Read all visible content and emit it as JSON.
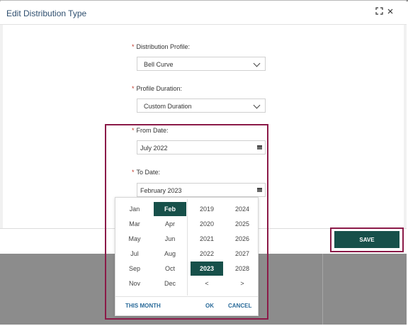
{
  "dialog": {
    "title": "Edit Distribution Type"
  },
  "form": {
    "distribution_profile": {
      "label": "Distribution Profile:",
      "required_mark": "*",
      "value": "Bell Curve"
    },
    "profile_duration": {
      "label": "Profile Duration:",
      "required_mark": "*",
      "value": "Custom Duration"
    },
    "from_date": {
      "label": "From Date:",
      "required_mark": "*",
      "value": "July 2022"
    },
    "to_date": {
      "label": "To Date:",
      "required_mark": "*",
      "value": "February 2023"
    }
  },
  "picker": {
    "months": [
      "Jan",
      "Feb",
      "Mar",
      "Apr",
      "May",
      "Jun",
      "Jul",
      "Aug",
      "Sep",
      "Oct",
      "Nov",
      "Dec"
    ],
    "selected_month": "Feb",
    "years": [
      "2019",
      "2024",
      "2020",
      "2025",
      "2021",
      "2026",
      "2022",
      "2027",
      "2023",
      "2028"
    ],
    "selected_year": "2023",
    "prev_label": "<",
    "next_label": ">",
    "this_month_label": "THIS MONTH",
    "ok_label": "OK",
    "cancel_label": "CANCEL"
  },
  "footer": {
    "save_label": "SAVE"
  },
  "colors": {
    "accent": "#17504a",
    "highlight": "#8b1a48",
    "title": "#2f4f6f",
    "link": "#2a6b9a"
  },
  "icons": {
    "maximize": "expand-icon",
    "close": "close-icon",
    "dropdown": "chevron-down-icon",
    "calendar": "calendar-icon"
  }
}
